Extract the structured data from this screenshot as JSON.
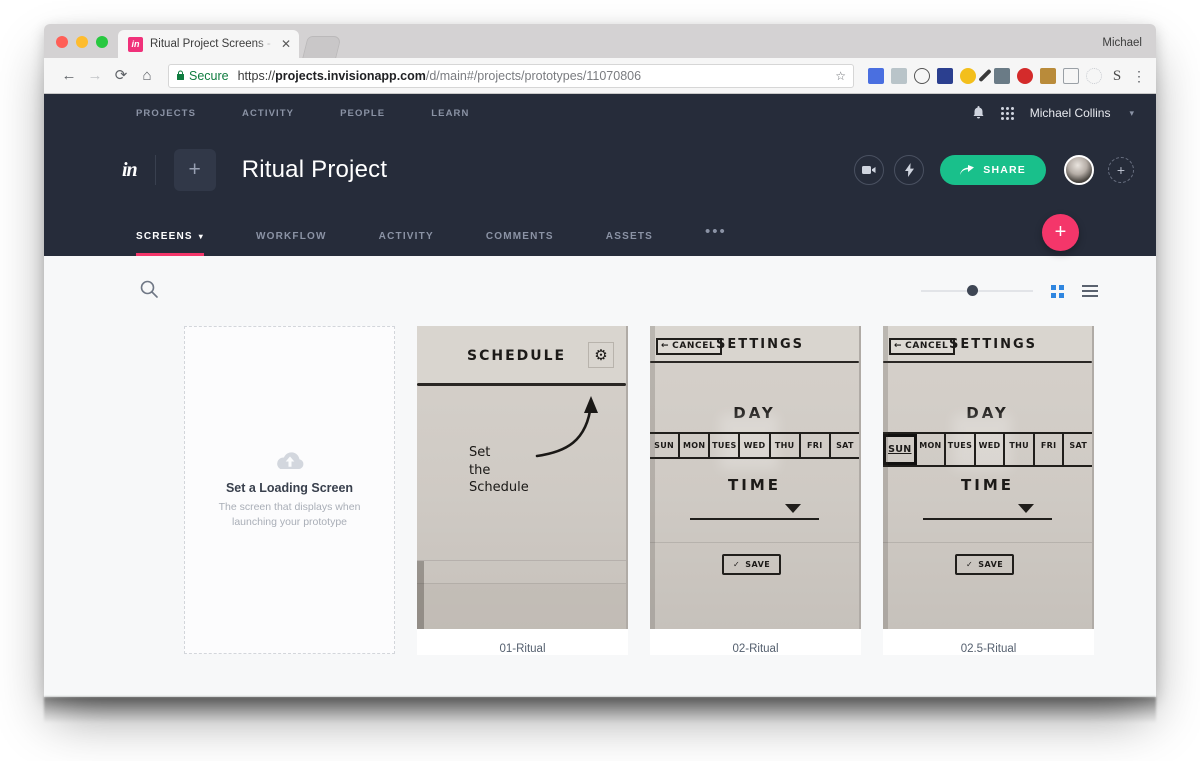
{
  "browser": {
    "profile_name": "Michael",
    "tab": {
      "title": "Ritual Project Screens - InVisio",
      "favicon_text": "in",
      "close_label": "✕"
    },
    "new_tab_label": "",
    "nav": {
      "back": "←",
      "forward": "→",
      "reload": "⟳",
      "home": "⌂"
    },
    "omnibox": {
      "lock_icon": "ὑ2",
      "secure_label": "Secure",
      "url_scheme": "https://",
      "url_host": "projects.invisionapp.com",
      "url_path": "/d/main#/projects/prototypes/11070806",
      "star_icon": "☆"
    },
    "extensions": [
      "pocket-icon",
      "eyedropper-icon",
      "info-icon",
      "image-icon",
      "cookie-icon",
      "pencil-icon",
      "ghostery-icon",
      "adblock-icon",
      "save-icon",
      "buffer-icon",
      "disabled-icon",
      "grammarly-icon",
      "menu-icon"
    ]
  },
  "topnav": {
    "links": [
      "PROJECTS",
      "ACTIVITY",
      "PEOPLE",
      "LEARN"
    ],
    "bell_icon": "ὑ4",
    "apps_icon": "apps-grid-icon",
    "user": "Michael Collins",
    "caret": "▾"
  },
  "project_header": {
    "logo": "in",
    "add_label": "+",
    "title": "Ritual Project",
    "video_icon": "▶",
    "bolt_icon": "⚡",
    "share_label": "SHARE",
    "share_icon": "➤",
    "share_color": "#19c08b",
    "add_member_label": "+"
  },
  "tabs": {
    "items": [
      {
        "label": "SCREENS",
        "active": true,
        "caret": "▾"
      },
      {
        "label": "WORKFLOW",
        "active": false
      },
      {
        "label": "ACTIVITY",
        "active": false
      },
      {
        "label": "COMMENTS",
        "active": false
      },
      {
        "label": "ASSETS",
        "active": false
      }
    ],
    "overflow": "•••",
    "active_underline_color": "#f4366a",
    "fab_label": "+",
    "fab_color": "#f4366a"
  },
  "toolbar": {
    "search_icon": "search-icon",
    "zoom_value": 41,
    "view_grid_label": "grid-view",
    "view_list_label": "list-view",
    "active_view": "grid"
  },
  "screens": [
    {
      "type": "placeholder",
      "title": "Set a Loading Screen",
      "subtitle": "The screen that displays when launching your prototype",
      "icon": "cloud-upload-icon"
    },
    {
      "type": "sketch",
      "label": "01-Ritual",
      "sketch": {
        "header_title": "SCHEDULE",
        "gear_icon": "⚙",
        "note_lines": [
          "Set",
          "the",
          "Schedule"
        ],
        "arrow": "curved-arrow-up"
      }
    },
    {
      "type": "sketch",
      "label": "02-Ritual",
      "sketch": {
        "cancel_label": "CANCEL",
        "cancel_arrow": "←",
        "header_title": "SETTINGS",
        "day_label": "DAY",
        "days": [
          "SUN",
          "MON",
          "TUES",
          "WED",
          "THU",
          "FRI",
          "SAT"
        ],
        "selected_day": null,
        "time_label": "TIME",
        "dropdown_icon": "▼",
        "save_label": "SAVE",
        "check_icon": "✓"
      }
    },
    {
      "type": "sketch",
      "label": "02.5-Ritual",
      "sketch": {
        "cancel_label": "CANCEL",
        "cancel_arrow": "←",
        "header_title": "SETTINGS",
        "day_label": "DAY",
        "days": [
          "SUN",
          "MON",
          "TUES",
          "WED",
          "THU",
          "FRI",
          "SAT"
        ],
        "selected_day": "SUN",
        "time_label": "TIME",
        "dropdown_icon": "▼",
        "save_label": "SAVE",
        "check_icon": "✓"
      }
    }
  ]
}
